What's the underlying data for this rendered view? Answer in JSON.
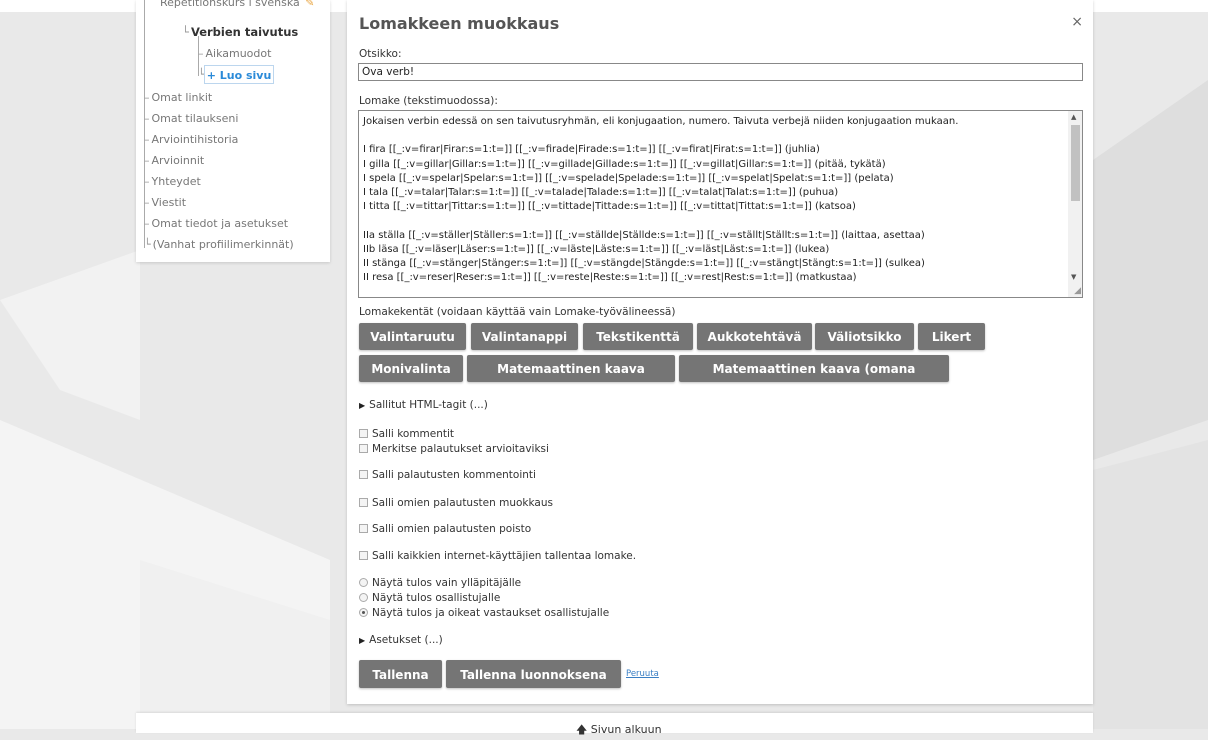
{
  "tree": {
    "items": [
      {
        "label": "Repetitionskurs i svenska",
        "pencil": "✎"
      },
      {
        "label": "Verbien taivutus"
      },
      {
        "label": "Aikamuodot"
      },
      {
        "label": "Omat linkit"
      },
      {
        "label": "Omat tilaukseni"
      },
      {
        "label": "Arviointihistoria"
      },
      {
        "label": "Arvioinnit"
      },
      {
        "label": "Yhteydet"
      },
      {
        "label": "Viestit"
      },
      {
        "label": "Omat tiedot ja asetukset"
      },
      {
        "label": "(Vanhat profiilimerkinnät)"
      }
    ],
    "new_page_label": "+ Luo sivu"
  },
  "modal": {
    "title": "Lomakkeen muokkaus",
    "close": "×",
    "title_label": "Otsikko:",
    "title_value": "Öva verb!",
    "form_label": "Lomake (tekstimuodossa):",
    "form_text": "Jokaisen verbin edessä on sen taivutusryhmän, eli konjugaation, numero. Taivuta verbejä niiden konjugaation mukaan.\n\nI fira [[_:v=firar|Firar:s=1:t=]] [[_:v=firade|Firade:s=1:t=]] [[_:v=firat|Firat:s=1:t=]] (juhlia)\nI gilla [[_:v=gillar|Gillar:s=1:t=]] [[_:v=gillade|Gillade:s=1:t=]] [[_:v=gillat|Gillar:s=1:t=]] (pitää, tykätä)\nI spela [[_:v=spelar|Spelar:s=1:t=]] [[_:v=spelade|Spelade:s=1:t=]] [[_:v=spelat|Spelat:s=1:t=]] (pelata)\nI tala [[_:v=talar|Talar:s=1:t=]] [[_:v=talade|Talade:s=1:t=]] [[_:v=talat|Talat:s=1:t=]] (puhua)\nI titta [[_:v=tittar|Tittar:s=1:t=]] [[_:v=tittade|Tittade:s=1:t=]] [[_:v=tittat|Tittat:s=1:t=]] (katsoa)\n\nIIa ställa [[_:v=ställer|Ställer:s=1:t=]] [[_:v=ställde|Ställde:s=1:t=]] [[_:v=ställt|Ställt:s=1:t=]] (laittaa, asettaa)\nIIb läsa [[_:v=läser|Läser:s=1:t=]] [[_:v=läste|Läste:s=1:t=]] [[_:v=läst|Läst:s=1:t=]] (lukea)\nII stänga [[_:v=stänger|Stänger:s=1:t=]] [[_:v=stängde|Stängde:s=1:t=]] [[_:v=stängt|Stängt:s=1:t=]] (sulkea)\nII resa [[_:v=reser|Reser:s=1:t=]] [[_:v=reste|Reste:s=1:t=]] [[_:v=rest|Rest:s=1:t=]] (matkustaa)",
    "fields_label": "Lomakekentät (voidaan käyttää vain Lomake-työvälineessä)",
    "tool_buttons_row1": [
      "Valintaruutu",
      "Valintanappi",
      "Tekstikenttä",
      "Aukkotehtävä",
      "Väliotsikko",
      "Likert"
    ],
    "tool_buttons_row2": [
      "Monivalinta",
      "Matemaattinen kaava (rivillä)",
      "Matemaattinen kaava (omana lohkona)"
    ],
    "html_tags": "Sallitut HTML-tagit (...)",
    "checkboxes": [
      "Salli kommentit",
      "Merkitse palautukset arvioitaviksi",
      "Salli palautusten kommentointi",
      "Salli omien palautusten muokkaus",
      "Salli omien palautusten poisto",
      "Salli kaikkien internet-käyttäjien tallentaa lomake."
    ],
    "radios": [
      "Näytä tulos vain ylläpitäjälle",
      "Näytä tulos osallistujalle",
      "Näytä tulos ja oikeat vastaukset osallistujalle"
    ],
    "radio_selected": "Näytä tulos ja oikeat vastaukset osallistujalle",
    "settings": "Asetukset (...)",
    "save": "Tallenna",
    "save_draft": "Tallenna luonnoksena",
    "cancel": "Peruuta"
  },
  "footer": {
    "back_to_top": "🡅 Sivun alkuun"
  }
}
